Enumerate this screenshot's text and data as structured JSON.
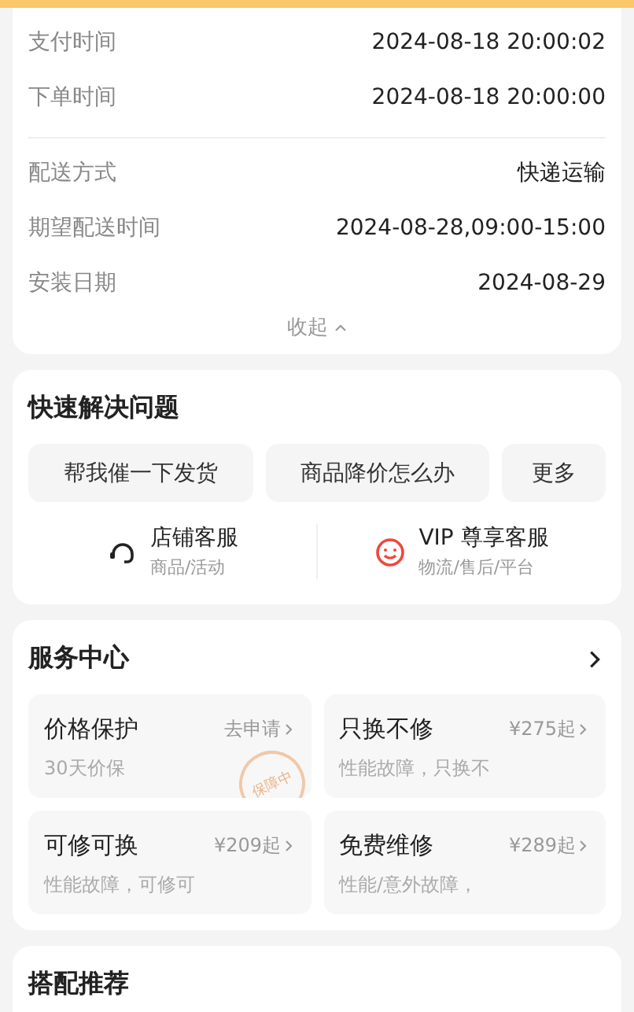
{
  "order_info": {
    "groups": [
      [
        {
          "label": "支付时间",
          "value": "2024-08-18 20:00:02"
        },
        {
          "label": "下单时间",
          "value": "2024-08-18 20:00:00"
        }
      ],
      [
        {
          "label": "配送方式",
          "value": "快递运输"
        },
        {
          "label": "期望配送时间",
          "value": "2024-08-28,09:00-15:00"
        },
        {
          "label": "安装日期",
          "value": "2024-08-29"
        }
      ]
    ],
    "collapse": {
      "label": "收起",
      "expanded": true
    }
  },
  "quick_help": {
    "title": "快速解决问题",
    "chips": [
      "帮我催一下发货",
      "商品降价怎么办",
      "更多"
    ],
    "services": [
      {
        "kind": "headset",
        "name": "店铺客服",
        "desc": "商品/活动"
      },
      {
        "kind": "smile",
        "name": "VIP 尊享客服",
        "desc": "物流/售后/平台"
      }
    ]
  },
  "service_center": {
    "title": "服务中心",
    "cards": [
      {
        "name": "价格保护",
        "action": "去申请",
        "desc": "30天价保",
        "stamp": "保障中"
      },
      {
        "name": "只换不修",
        "action": "¥275起",
        "desc": "性能故障，只换不"
      },
      {
        "name": "可修可换",
        "action": "¥209起",
        "desc": "性能故障，可修可"
      },
      {
        "name": "免费维修",
        "action": "¥289起",
        "desc": "性能/意外故障，"
      }
    ]
  },
  "recommend": {
    "title": "搭配推荐"
  }
}
